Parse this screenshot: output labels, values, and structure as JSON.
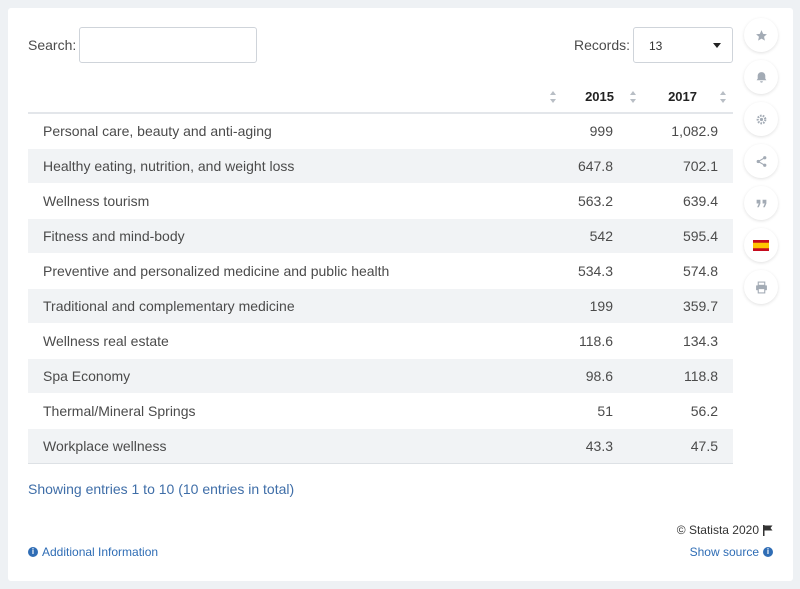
{
  "search": {
    "label": "Search:",
    "value": ""
  },
  "records": {
    "label": "Records:",
    "value": "13"
  },
  "table": {
    "headers": [
      "",
      "2015",
      "2017"
    ],
    "rows": [
      [
        "Personal care, beauty and anti-aging",
        "999",
        "1,082.9"
      ],
      [
        "Healthy eating, nutrition, and weight loss",
        "647.8",
        "702.1"
      ],
      [
        "Wellness tourism",
        "563.2",
        "639.4"
      ],
      [
        "Fitness and mind-body",
        "542",
        "595.4"
      ],
      [
        "Preventive and personalized medicine and public health",
        "534.3",
        "574.8"
      ],
      [
        "Traditional and complementary medicine",
        "199",
        "359.7"
      ],
      [
        "Wellness real estate",
        "118.6",
        "134.3"
      ],
      [
        "Spa Economy",
        "98.6",
        "118.8"
      ],
      [
        "Thermal/Mineral Springs",
        "51",
        "56.2"
      ],
      [
        "Workplace wellness",
        "43.3",
        "47.5"
      ]
    ]
  },
  "chart_data": {
    "type": "table",
    "columns": [
      "",
      "2015",
      "2017"
    ],
    "categories": [
      "Personal care, beauty and anti-aging",
      "Healthy eating, nutrition, and weight loss",
      "Wellness tourism",
      "Fitness and mind-body",
      "Preventive and personalized medicine and public health",
      "Traditional and complementary medicine",
      "Wellness real estate",
      "Spa Economy",
      "Thermal/Mineral Springs",
      "Workplace wellness"
    ],
    "series": [
      {
        "name": "2015",
        "values": [
          999,
          647.8,
          563.2,
          542,
          534.3,
          199,
          118.6,
          98.6,
          51,
          43.3
        ]
      },
      {
        "name": "2017",
        "values": [
          1082.9,
          702.1,
          639.4,
          595.4,
          574.8,
          359.7,
          134.3,
          118.8,
          56.2,
          47.5
        ]
      }
    ]
  },
  "footer": {
    "showing": "Showing entries 1 to 10 (10 entries in total)",
    "copyright": "© Statista 2020",
    "additional_info": "Additional Information",
    "show_source": "Show source"
  },
  "sidebar": {
    "icons": [
      "star-icon",
      "bell-icon",
      "gear-icon",
      "share-icon",
      "quote-icon",
      "spain-flag-icon",
      "print-icon"
    ]
  },
  "colors": {
    "link": "#2f6db5",
    "row_alt": "#f1f3f5",
    "background": "#eef1f4"
  }
}
